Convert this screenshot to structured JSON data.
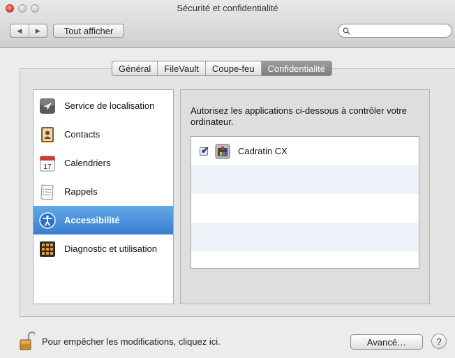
{
  "window": {
    "title": "Sécurité et confidentialité"
  },
  "toolbar": {
    "back_glyph": "◀",
    "forward_glyph": "▶",
    "show_all_label": "Tout afficher",
    "search_placeholder": ""
  },
  "tabs": [
    {
      "label": "Général",
      "active": false
    },
    {
      "label": "FileVault",
      "active": false
    },
    {
      "label": "Coupe-feu",
      "active": false
    },
    {
      "label": "Confidentialité",
      "active": true
    }
  ],
  "sidebar": {
    "selected": "Accessibilité",
    "items": [
      {
        "label": "Service de localisation",
        "icon": "location-arrow-icon"
      },
      {
        "label": "Contacts",
        "icon": "contacts-book-icon"
      },
      {
        "label": "Calendriers",
        "icon": "calendar-icon",
        "icon_text": "17"
      },
      {
        "label": "Rappels",
        "icon": "reminders-icon"
      },
      {
        "label": "Accessibilité",
        "icon": "accessibility-icon"
      },
      {
        "label": "Diagnostic et utilisation",
        "icon": "diagnostics-icon"
      }
    ]
  },
  "main": {
    "description": "Autorisez les applications ci-dessous à contrôler votre ordinateur.",
    "apps": [
      {
        "name": "Cadratin CX",
        "checked": true,
        "icon": "cadratin-app-icon"
      }
    ]
  },
  "footer": {
    "lock_text": "Pour empêcher les modifications, cliquez ici.",
    "advanced_label": "Avancé…",
    "help_label": "?"
  },
  "colors": {
    "selection_blue": "#3a7fd0",
    "active_tab": "#8a8a8a",
    "alt_row": "#eef2f8"
  }
}
